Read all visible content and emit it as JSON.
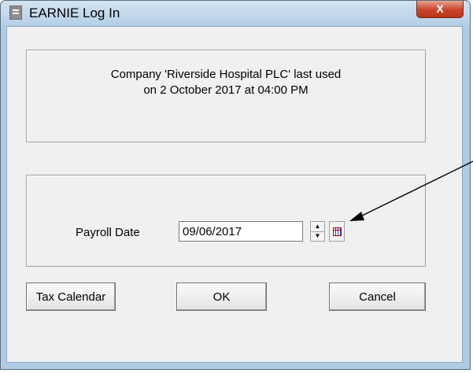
{
  "window": {
    "title": "EARNIE Log In",
    "close_label": "X"
  },
  "info": {
    "line1": "Company 'Riverside Hospital PLC' last used",
    "line2": "on 2 October 2017 at 04:00 PM"
  },
  "payroll": {
    "label": "Payroll Date",
    "value": "09/06/2017"
  },
  "buttons": {
    "tax_calendar": "Tax Calendar",
    "ok": "OK",
    "cancel": "Cancel"
  }
}
